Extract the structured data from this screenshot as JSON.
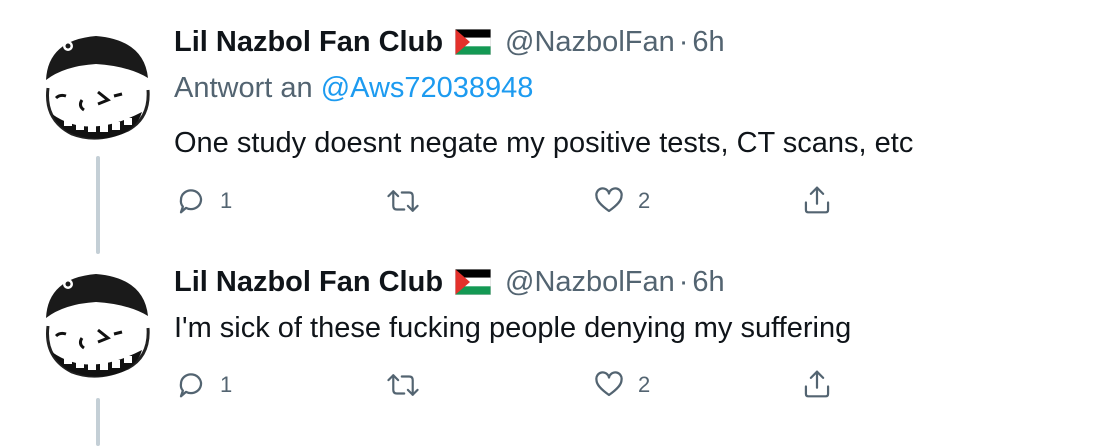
{
  "tweets": [
    {
      "display_name": "Lil Nazbol Fan Club",
      "flag_icon": "palestine-flag-icon",
      "handle": "@NazbolFan",
      "separator": "·",
      "time": "6h",
      "reply_prefix": "Antwort an",
      "reply_mention": "@Aws72038948",
      "text": "One study doesnt negate my positive tests, CT scans, etc",
      "reply_count": "1",
      "retweet_count": "",
      "like_count": "2"
    },
    {
      "display_name": "Lil Nazbol Fan Club",
      "flag_icon": "palestine-flag-icon",
      "handle": "@NazbolFan",
      "separator": "·",
      "time": "6h",
      "text": "I'm sick of these fucking people denying my suffering",
      "reply_count": "1",
      "retweet_count": "",
      "like_count": "2"
    }
  ],
  "colors": {
    "text": "#0f1419",
    "secondary": "#536471",
    "link": "#1d9bf0",
    "thread_line": "#c4cfd6"
  }
}
